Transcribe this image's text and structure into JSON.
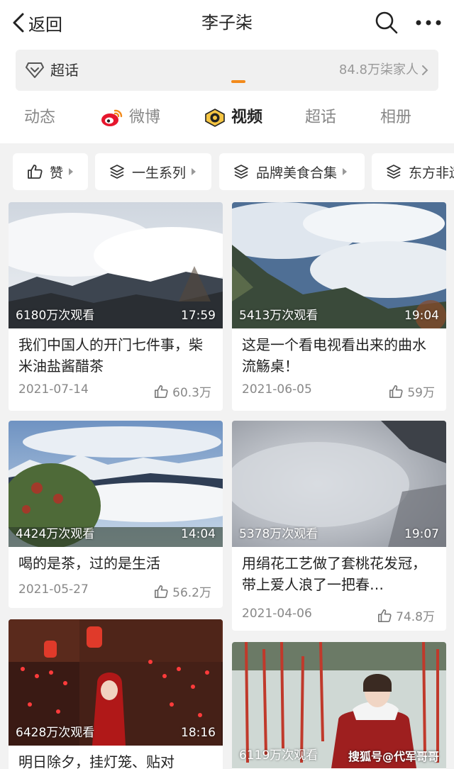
{
  "nav": {
    "back_label": "返回",
    "title": "李子柒"
  },
  "chaohua": {
    "label": "超话",
    "fans": "84.8万柒家人"
  },
  "tabs": [
    "动态",
    "微博",
    "视频",
    "超话",
    "相册"
  ],
  "chips": [
    "赞",
    "一生系列",
    "品牌美食合集",
    "东方非遗"
  ],
  "videos": [
    {
      "views": "6180万次观看",
      "duration": "17:59",
      "title": "我们中国人的开门七件事，柴米油盐酱醋茶",
      "date": "2021-07-14",
      "likes": "60.3万"
    },
    {
      "views": "5413万次观看",
      "duration": "19:04",
      "title": "这是一个看电视看出来的曲水流觞桌！",
      "date": "2021-06-05",
      "likes": "59万"
    },
    {
      "views": "4424万次观看",
      "duration": "14:04",
      "title": "喝的是茶，过的是生活",
      "date": "2021-05-27",
      "likes": "56.2万"
    },
    {
      "views": "5378万次观看",
      "duration": "19:07",
      "title": "用绢花工艺做了套桃花发冠，带上爱人浪了一把春…",
      "date": "2021-04-06",
      "likes": "74.8万"
    },
    {
      "views": "6428万次观看",
      "duration": "18:16",
      "title": "明日除夕，挂灯笼、贴对",
      "date": "",
      "likes": ""
    },
    {
      "views": "6119万次观看",
      "duration": "",
      "title": "",
      "date": "",
      "likes": ""
    }
  ],
  "watermark": "搜狐号@代军哥哥",
  "colors": {
    "accent": "#f28a1b",
    "weibo_red": "#e6162d"
  },
  "icons": [
    "chevron-left-icon",
    "search-icon",
    "more-icon",
    "diamond-icon",
    "chevron-right-icon",
    "weibo-icon",
    "video-icon",
    "thumb-up-icon",
    "layers-icon"
  ]
}
